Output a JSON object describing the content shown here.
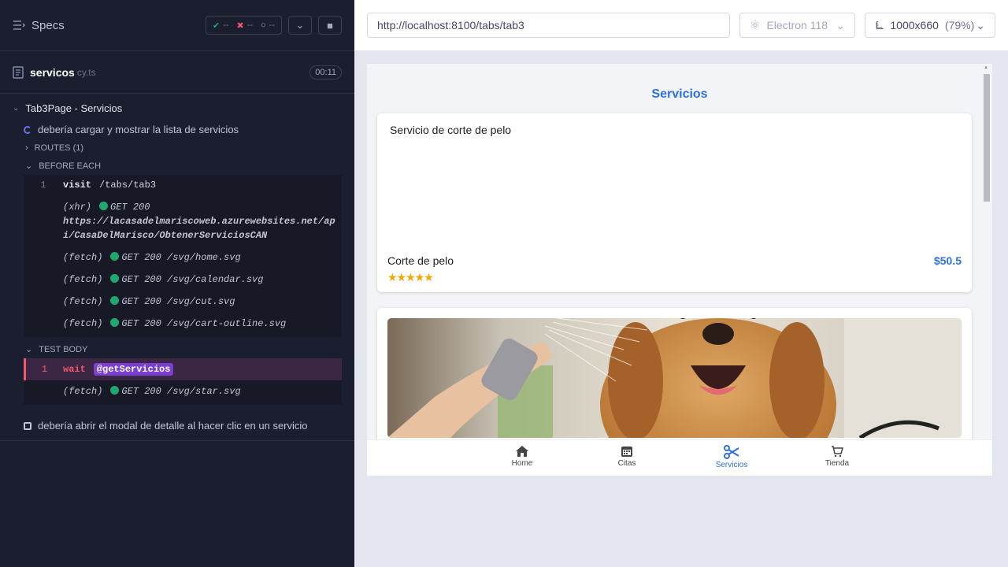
{
  "sidebar": {
    "specs_label": "Specs",
    "stats": {
      "passed": "--",
      "failed": "--",
      "pending": "--"
    },
    "spec": {
      "name": "servicos",
      "ext": "cy.ts",
      "duration": "00:11"
    },
    "suite": "Tab3Page - Servicios",
    "test1": "debería cargar y mostrar la lista de servicios",
    "routes": "ROUTES (1)",
    "before_each": "BEFORE EACH",
    "test_body": "TEST BODY",
    "test2": "debería abrir el modal de detalle al hacer clic en un servicio",
    "before_cmds": [
      {
        "num": "1",
        "name": "visit",
        "msg": "/tabs/tab3"
      },
      {
        "paren": "(xhr)",
        "msg": "GET 200",
        "url": "https://lacasadelmariscoweb.azurewebsites.net/api/CasaDelMarisco/ObtenerServiciosCAN"
      },
      {
        "paren": "(fetch)",
        "msg": "GET 200 /svg/home.svg"
      },
      {
        "paren": "(fetch)",
        "msg": "GET 200 /svg/calendar.svg"
      },
      {
        "paren": "(fetch)",
        "msg": "GET 200 /svg/cut.svg"
      },
      {
        "paren": "(fetch)",
        "msg": "GET 200 /svg/cart-outline.svg"
      }
    ],
    "body_cmds": [
      {
        "num": "1",
        "name": "wait",
        "alias": "@getServicios"
      },
      {
        "paren": "(fetch)",
        "msg": "GET 200 /svg/star.svg"
      }
    ]
  },
  "preview": {
    "url": "http://localhost:8100/tabs/tab3",
    "browser": "Electron 118",
    "viewport": "1000x660",
    "zoom": "(79%)"
  },
  "app": {
    "title": "Servicios",
    "card1": {
      "img_alt": "Servicio de corte de pelo",
      "name": "Corte de pelo",
      "price": "$50.5",
      "stars": "★★★★★",
      "rating": 5
    },
    "tabs": [
      {
        "label": "Home",
        "icon": "home-icon"
      },
      {
        "label": "Citas",
        "icon": "calendar-icon"
      },
      {
        "label": "Servicios",
        "icon": "scissors-icon"
      },
      {
        "label": "Tienda",
        "icon": "cart-icon"
      }
    ]
  },
  "colors": {
    "accent": "#2d6fe0",
    "pass": "#1fa971",
    "fail": "#f15a6a",
    "alias": "#7a3fd0",
    "star": "#f5a700"
  }
}
